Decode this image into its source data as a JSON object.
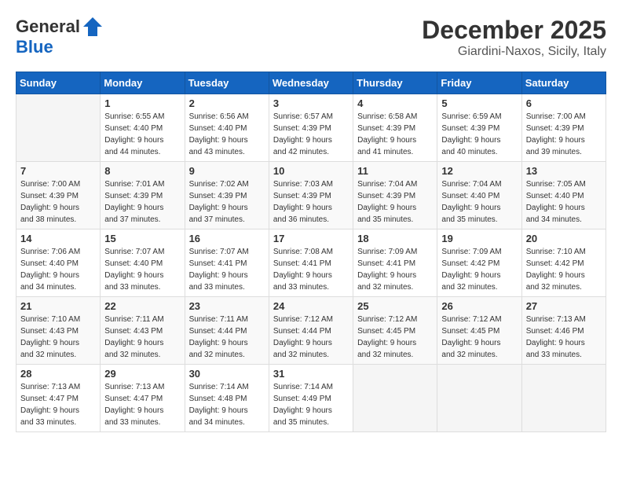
{
  "header": {
    "logo_line1": "General",
    "logo_line2": "Blue",
    "month": "December 2025",
    "location": "Giardini-Naxos, Sicily, Italy"
  },
  "weekdays": [
    "Sunday",
    "Monday",
    "Tuesday",
    "Wednesday",
    "Thursday",
    "Friday",
    "Saturday"
  ],
  "weeks": [
    [
      {
        "day": "",
        "info": ""
      },
      {
        "day": "1",
        "info": "Sunrise: 6:55 AM\nSunset: 4:40 PM\nDaylight: 9 hours\nand 44 minutes."
      },
      {
        "day": "2",
        "info": "Sunrise: 6:56 AM\nSunset: 4:40 PM\nDaylight: 9 hours\nand 43 minutes."
      },
      {
        "day": "3",
        "info": "Sunrise: 6:57 AM\nSunset: 4:39 PM\nDaylight: 9 hours\nand 42 minutes."
      },
      {
        "day": "4",
        "info": "Sunrise: 6:58 AM\nSunset: 4:39 PM\nDaylight: 9 hours\nand 41 minutes."
      },
      {
        "day": "5",
        "info": "Sunrise: 6:59 AM\nSunset: 4:39 PM\nDaylight: 9 hours\nand 40 minutes."
      },
      {
        "day": "6",
        "info": "Sunrise: 7:00 AM\nSunset: 4:39 PM\nDaylight: 9 hours\nand 39 minutes."
      }
    ],
    [
      {
        "day": "7",
        "info": "Sunrise: 7:00 AM\nSunset: 4:39 PM\nDaylight: 9 hours\nand 38 minutes."
      },
      {
        "day": "8",
        "info": "Sunrise: 7:01 AM\nSunset: 4:39 PM\nDaylight: 9 hours\nand 37 minutes."
      },
      {
        "day": "9",
        "info": "Sunrise: 7:02 AM\nSunset: 4:39 PM\nDaylight: 9 hours\nand 37 minutes."
      },
      {
        "day": "10",
        "info": "Sunrise: 7:03 AM\nSunset: 4:39 PM\nDaylight: 9 hours\nand 36 minutes."
      },
      {
        "day": "11",
        "info": "Sunrise: 7:04 AM\nSunset: 4:39 PM\nDaylight: 9 hours\nand 35 minutes."
      },
      {
        "day": "12",
        "info": "Sunrise: 7:04 AM\nSunset: 4:40 PM\nDaylight: 9 hours\nand 35 minutes."
      },
      {
        "day": "13",
        "info": "Sunrise: 7:05 AM\nSunset: 4:40 PM\nDaylight: 9 hours\nand 34 minutes."
      }
    ],
    [
      {
        "day": "14",
        "info": "Sunrise: 7:06 AM\nSunset: 4:40 PM\nDaylight: 9 hours\nand 34 minutes."
      },
      {
        "day": "15",
        "info": "Sunrise: 7:07 AM\nSunset: 4:40 PM\nDaylight: 9 hours\nand 33 minutes."
      },
      {
        "day": "16",
        "info": "Sunrise: 7:07 AM\nSunset: 4:41 PM\nDaylight: 9 hours\nand 33 minutes."
      },
      {
        "day": "17",
        "info": "Sunrise: 7:08 AM\nSunset: 4:41 PM\nDaylight: 9 hours\nand 33 minutes."
      },
      {
        "day": "18",
        "info": "Sunrise: 7:09 AM\nSunset: 4:41 PM\nDaylight: 9 hours\nand 32 minutes."
      },
      {
        "day": "19",
        "info": "Sunrise: 7:09 AM\nSunset: 4:42 PM\nDaylight: 9 hours\nand 32 minutes."
      },
      {
        "day": "20",
        "info": "Sunrise: 7:10 AM\nSunset: 4:42 PM\nDaylight: 9 hours\nand 32 minutes."
      }
    ],
    [
      {
        "day": "21",
        "info": "Sunrise: 7:10 AM\nSunset: 4:43 PM\nDaylight: 9 hours\nand 32 minutes."
      },
      {
        "day": "22",
        "info": "Sunrise: 7:11 AM\nSunset: 4:43 PM\nDaylight: 9 hours\nand 32 minutes."
      },
      {
        "day": "23",
        "info": "Sunrise: 7:11 AM\nSunset: 4:44 PM\nDaylight: 9 hours\nand 32 minutes."
      },
      {
        "day": "24",
        "info": "Sunrise: 7:12 AM\nSunset: 4:44 PM\nDaylight: 9 hours\nand 32 minutes."
      },
      {
        "day": "25",
        "info": "Sunrise: 7:12 AM\nSunset: 4:45 PM\nDaylight: 9 hours\nand 32 minutes."
      },
      {
        "day": "26",
        "info": "Sunrise: 7:12 AM\nSunset: 4:45 PM\nDaylight: 9 hours\nand 32 minutes."
      },
      {
        "day": "27",
        "info": "Sunrise: 7:13 AM\nSunset: 4:46 PM\nDaylight: 9 hours\nand 33 minutes."
      }
    ],
    [
      {
        "day": "28",
        "info": "Sunrise: 7:13 AM\nSunset: 4:47 PM\nDaylight: 9 hours\nand 33 minutes."
      },
      {
        "day": "29",
        "info": "Sunrise: 7:13 AM\nSunset: 4:47 PM\nDaylight: 9 hours\nand 33 minutes."
      },
      {
        "day": "30",
        "info": "Sunrise: 7:14 AM\nSunset: 4:48 PM\nDaylight: 9 hours\nand 34 minutes."
      },
      {
        "day": "31",
        "info": "Sunrise: 7:14 AM\nSunset: 4:49 PM\nDaylight: 9 hours\nand 35 minutes."
      },
      {
        "day": "",
        "info": ""
      },
      {
        "day": "",
        "info": ""
      },
      {
        "day": "",
        "info": ""
      }
    ]
  ]
}
